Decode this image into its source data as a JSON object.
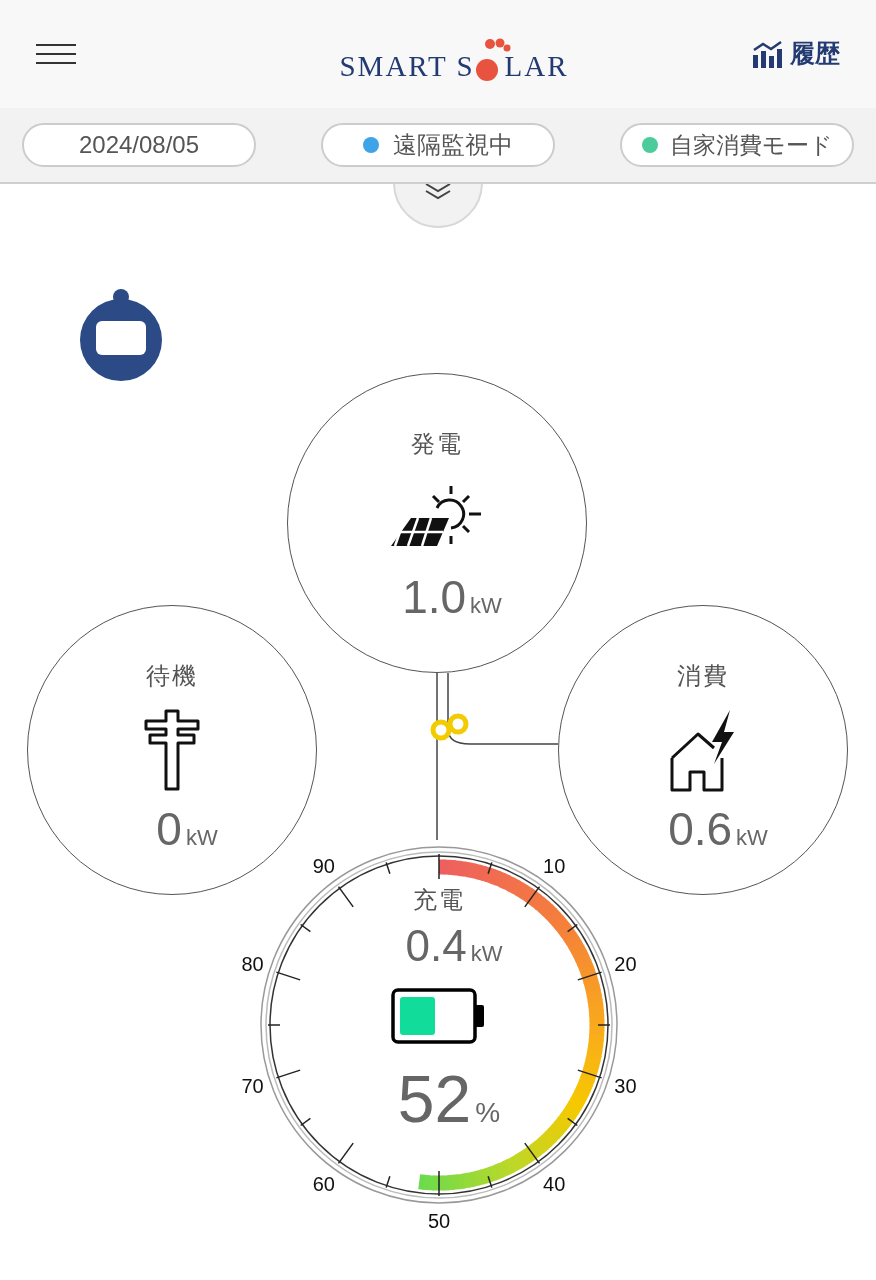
{
  "header": {
    "logo_left": "SMART S",
    "logo_right": "LAR",
    "history": "履歴"
  },
  "status_bar": {
    "date": "2024/08/05",
    "monitor": {
      "label": "遠隔監視中",
      "color": "#3fa3e8"
    },
    "mode": {
      "label": "自家消費モード",
      "color": "#4ccc9a"
    }
  },
  "generation": {
    "label": "発電",
    "value": "1.0",
    "unit": "kW"
  },
  "standby": {
    "label": "待機",
    "value": "0",
    "unit": "kW"
  },
  "consumption": {
    "label": "消費",
    "value": "0.6",
    "unit": "kW"
  },
  "battery": {
    "label": "充電",
    "value": "0.4",
    "unit": "kW",
    "percent": "52",
    "percent_unit": "%",
    "scale": [
      "10",
      "20",
      "30",
      "40",
      "50",
      "60",
      "70",
      "80",
      "90"
    ]
  }
}
